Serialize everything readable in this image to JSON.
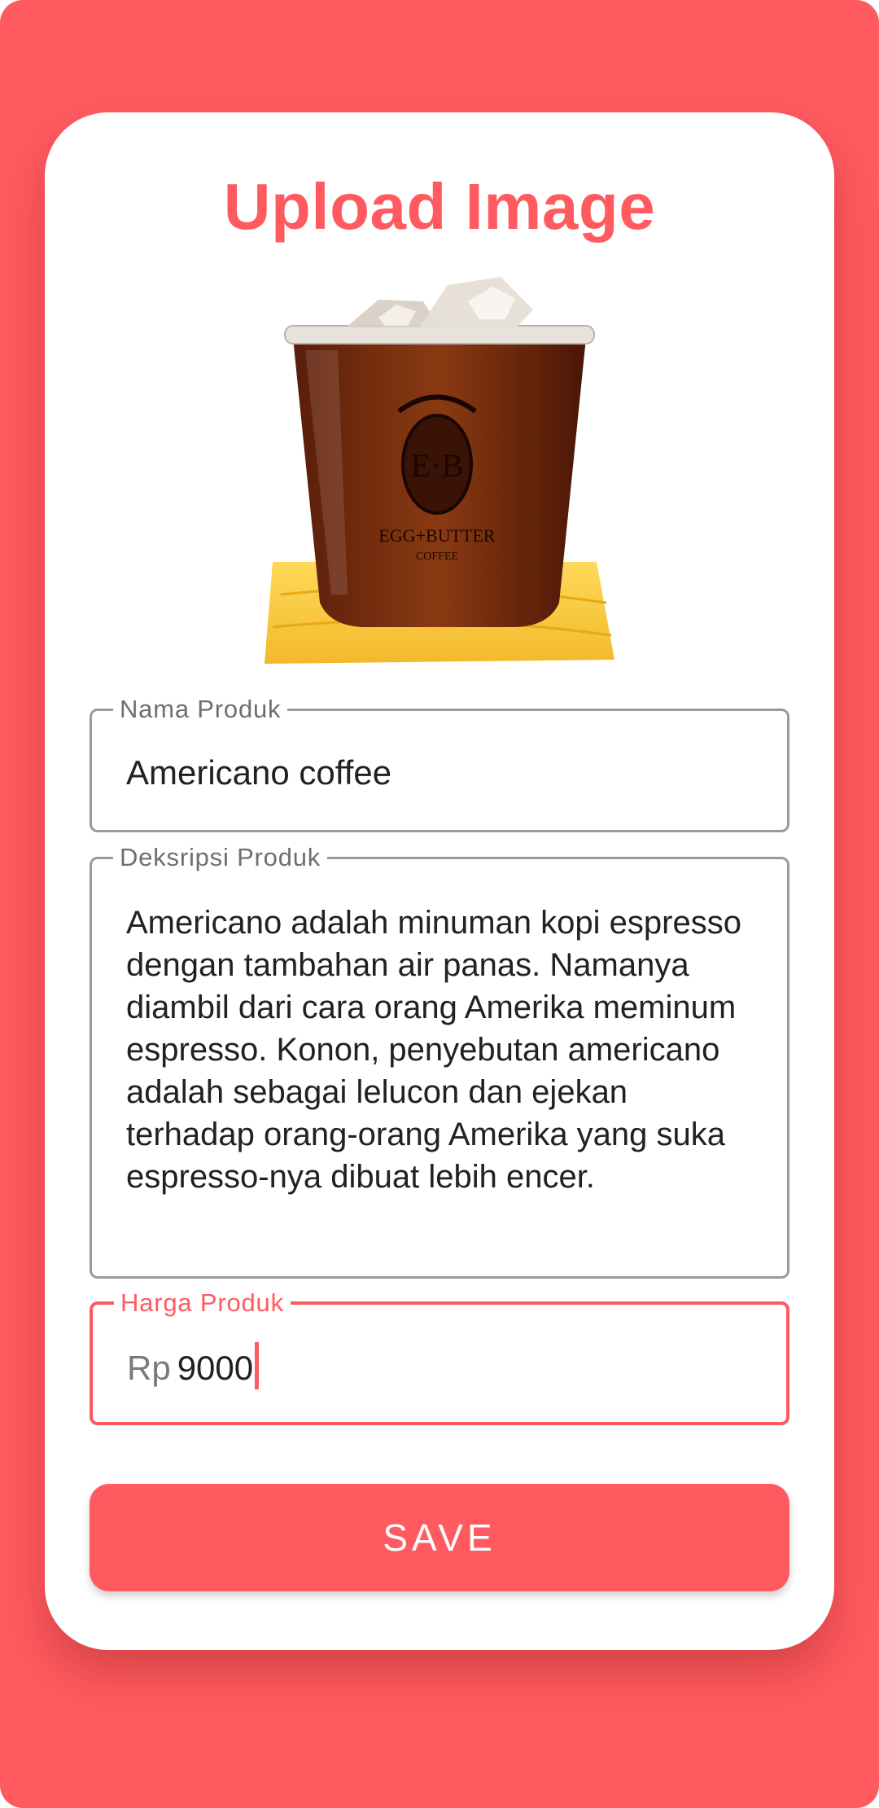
{
  "screen": {
    "title": "Upload Image",
    "accent_color": "#FF5A5F"
  },
  "image": {
    "alt": "iced americano coffee cup",
    "logo_text": "E·B",
    "brand_text": "EGG+BUTTER",
    "brand_sub": "COFFEE"
  },
  "form": {
    "name": {
      "label": "Nama Produk",
      "value": "Americano coffee"
    },
    "description": {
      "label": "Deksripsi Produk",
      "value": "Americano adalah minuman kopi espresso dengan tambahan air panas. Namanya diambil dari cara orang Amerika meminum espresso. Konon, penyebutan americano adalah sebagai lelucon dan ejekan terhadap orang-orang Amerika yang suka espresso-nya dibuat lebih encer."
    },
    "price": {
      "label": "Harga Produk",
      "prefix": "Rp",
      "value": "9000"
    }
  },
  "actions": {
    "save_label": "SAVE"
  }
}
